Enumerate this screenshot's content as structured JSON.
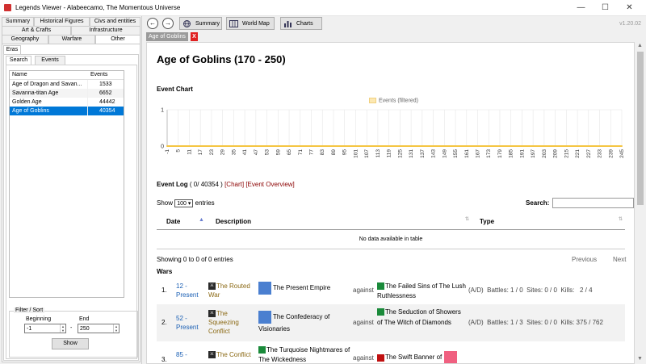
{
  "window": {
    "title": "Legends Viewer - Alabeecamo, The Momentous Universe",
    "minimize": "—",
    "maximize": "☐",
    "close": "✕"
  },
  "left_tabs_row1": [
    "Summary",
    "Historical Figures",
    "Civs and entities"
  ],
  "left_tabs_row2": [
    "Art & Crafts",
    "Infrastructure"
  ],
  "left_tabs_row3": [
    "Geography",
    "Warfare",
    "Other"
  ],
  "subtab": "Eras",
  "search_tabs": [
    "Search",
    "Events"
  ],
  "eras_list": {
    "columns": [
      "Name",
      "Events"
    ],
    "rows": [
      {
        "name": "Age of Dragon and Savan...",
        "events": "1533",
        "selected": false
      },
      {
        "name": "Savanna-titan Age",
        "events": "6652",
        "selected": false
      },
      {
        "name": "Golden Age",
        "events": "44442",
        "selected": false
      },
      {
        "name": "Age of Goblins",
        "events": "40354",
        "selected": true
      }
    ]
  },
  "filter": {
    "title": "Filter / Sort",
    "beginning_label": "Beginning",
    "end_label": "End",
    "beginning_value": "-1",
    "end_value": "250",
    "dash": "-",
    "show_button": "Show"
  },
  "toolbar": {
    "back": "←",
    "forward": "→",
    "summary": "Summary",
    "world_map": "World Map",
    "charts": "Charts",
    "version": "v1.20.02"
  },
  "doc_tab": {
    "label": "Age of Goblins",
    "close": "X"
  },
  "page": {
    "title": "Age of Goblins (170 - 250)",
    "event_chart_heading": "Event Chart",
    "legend_label": "Events (filtered)",
    "event_log_heading": "Event Log",
    "event_log_count": "( 0/ 40354 )",
    "chart_link": "[Chart]",
    "overview_link": "[Event Overview]",
    "show_label": "Show",
    "entries_value": "100",
    "entries_label": "entries",
    "search_label": "Search:",
    "table_headers": [
      "Date",
      "Description",
      "Type"
    ],
    "no_data": "No data available in table",
    "showing": "Showing 0 to 0 of 0 entries",
    "previous": "Previous",
    "next": "Next",
    "wars_heading": "Wars"
  },
  "chart_data": {
    "type": "line",
    "x_ticks": [
      "-1",
      "5",
      "11",
      "17",
      "23",
      "29",
      "35",
      "41",
      "47",
      "53",
      "59",
      "65",
      "71",
      "77",
      "83",
      "89",
      "95",
      "101",
      "107",
      "113",
      "119",
      "125",
      "131",
      "137",
      "143",
      "149",
      "155",
      "161",
      "167",
      "173",
      "179",
      "185",
      "191",
      "197",
      "203",
      "209",
      "215",
      "221",
      "227",
      "233",
      "239",
      "245"
    ],
    "ylim": [
      0,
      1
    ],
    "y_ticks": [
      "0",
      "1"
    ],
    "series": [
      {
        "name": "Events (filtered)",
        "values": [
          0,
          0,
          0,
          0,
          0,
          0,
          0,
          0,
          0,
          0,
          0,
          0,
          0,
          0,
          0,
          0,
          0,
          0,
          0,
          0,
          0,
          0,
          0,
          0,
          0,
          0,
          0,
          0,
          0,
          0,
          0,
          0,
          0,
          0,
          0,
          0,
          0,
          0,
          0,
          0,
          0,
          0
        ]
      }
    ]
  },
  "wars": [
    {
      "num": "1.",
      "date1": "12 -",
      "date2": "Present",
      "war": "The Routed War",
      "attacker": "The Present Empire",
      "against": "against",
      "defender": "The Failed Sins of The Lush Ruthlessness",
      "ad": "(A/D)",
      "battles": "Battles:",
      "b1": "1",
      "b2": "0",
      "sites": "Sites:",
      "s1": "0",
      "s2": "0",
      "kills": "Kills:",
      "k1": "2",
      "k2": "4",
      "slash": "/"
    },
    {
      "num": "2.",
      "date1": "52 -",
      "date2": "Present",
      "war": "The Squeezing Conflict",
      "attacker": "The Confederacy of Visionaries",
      "against": "against",
      "defender": "The Seduction of Showers of The Witch of Diamonds",
      "ad": "(A/D)",
      "battles": "Battles:",
      "b1": "1",
      "b2": "3",
      "sites": "Sites:",
      "s1": "0",
      "s2": "0",
      "kills": "Kills:",
      "k1": "375",
      "k2": "762",
      "slash": "/"
    },
    {
      "num": "3.",
      "date1": "85 -",
      "date2": "",
      "war": "The Conflict",
      "attacker": "The Turquoise Nightmares of The Wickedness",
      "against": "against",
      "defender": "The Swift Banner of",
      "ad": "",
      "battles": "",
      "b1": "",
      "b2": "",
      "sites": "",
      "s1": "",
      "s2": "",
      "kills": "",
      "k1": "",
      "k2": "",
      "slash": ""
    }
  ]
}
